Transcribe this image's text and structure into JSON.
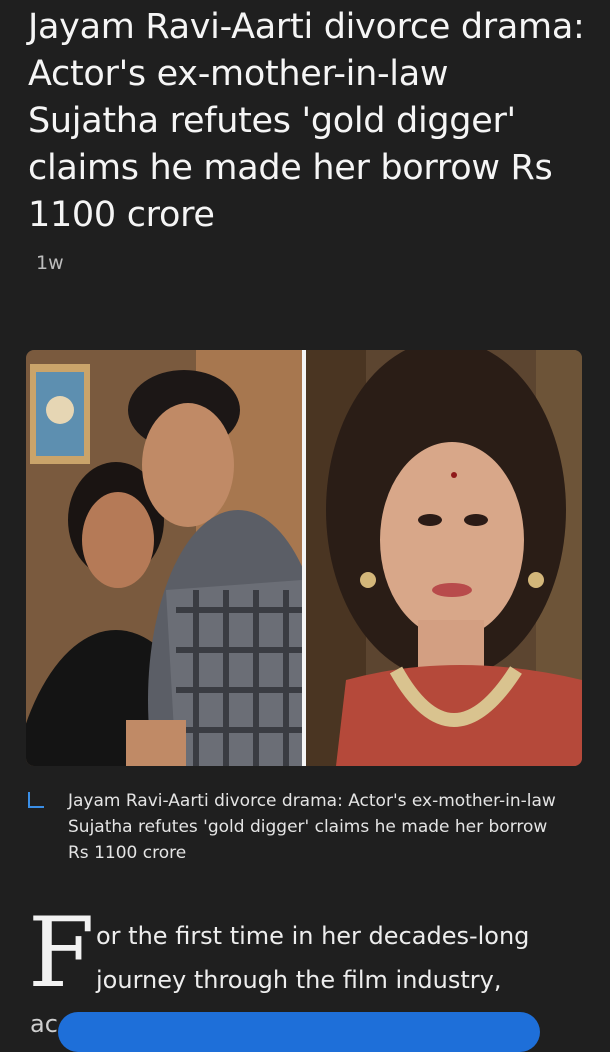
{
  "article": {
    "headline": "Jayam Ravi-Aarti divorce drama: Actor's ex-mother-in-law Sujatha refutes 'gold digger' claims he made her borrow Rs 1100 crore",
    "age": "1w"
  },
  "hero_image": {
    "caption": "Jayam Ravi-Aarti divorce drama: Actor's ex-mother-in-law Sujatha refutes 'gold digger' claims he made her borrow Rs 1100 crore"
  },
  "body": {
    "drop_cap": "F",
    "lead_line1": "or the first time in her decades-long",
    "lead_line2": "journey through the film industry,",
    "lead_line3": "ac"
  },
  "colors": {
    "background": "#1f1f1f",
    "caption_accent": "#3a8ee6",
    "action_pill": "#1e6fd9"
  }
}
